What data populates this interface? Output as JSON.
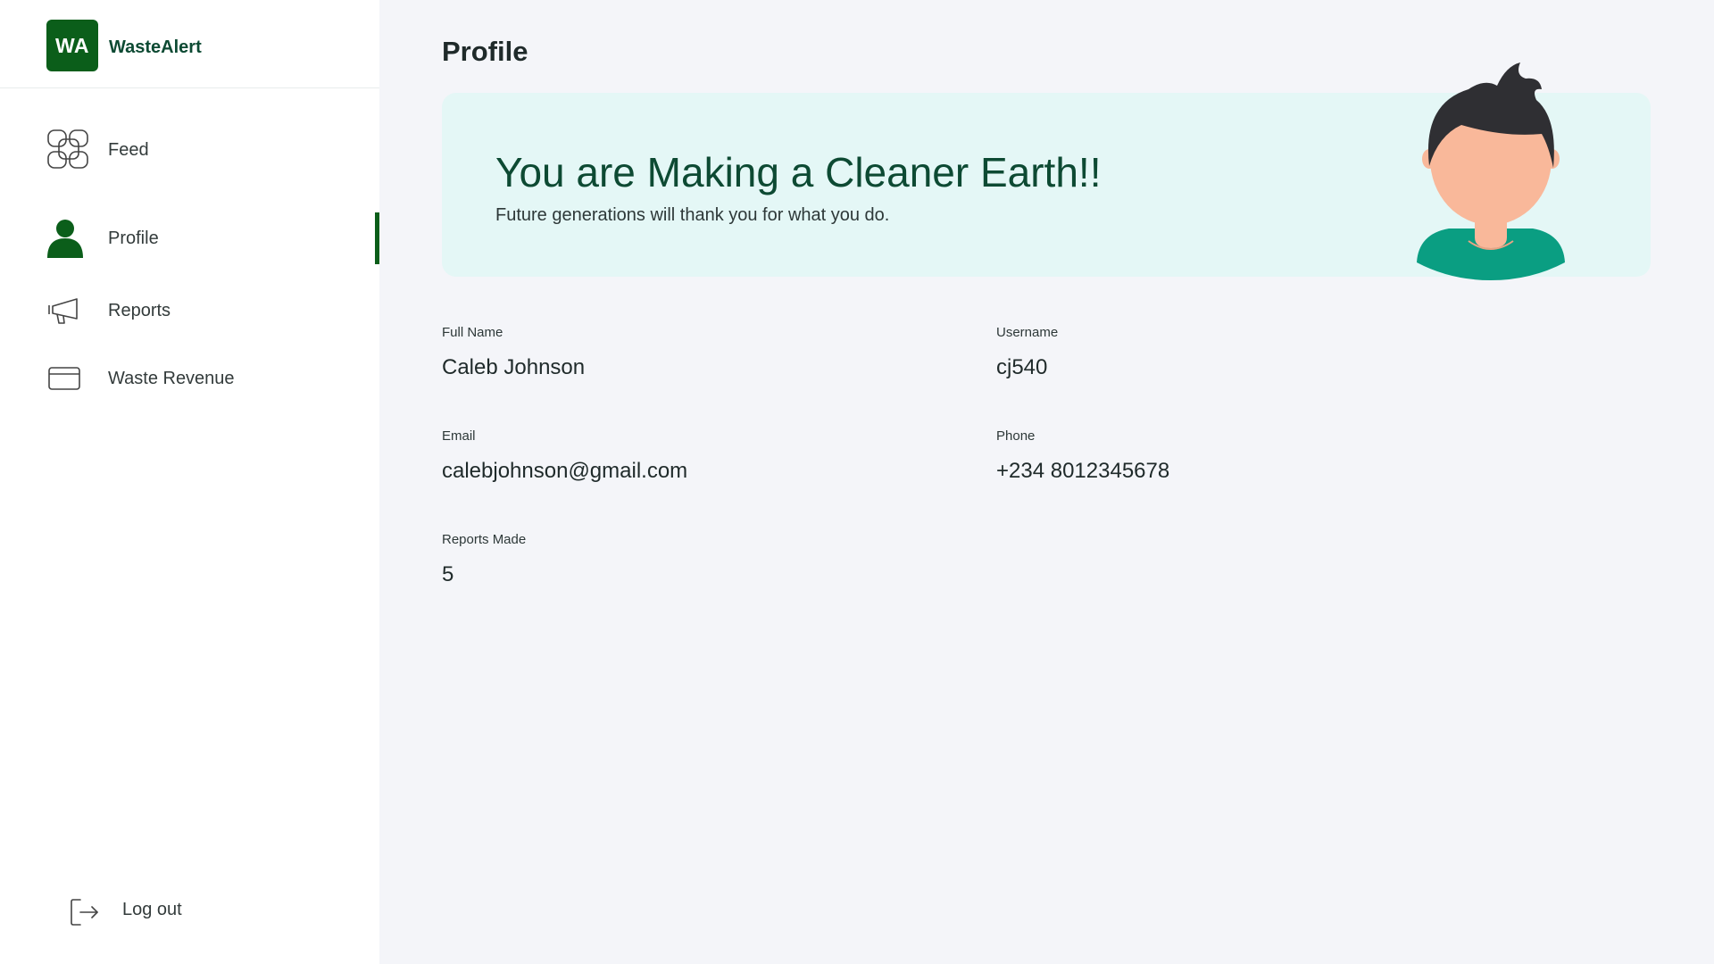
{
  "brand": {
    "logo_text": "WA",
    "name": "WasteAlert",
    "color": "#0b5e1a"
  },
  "sidebar": {
    "items": [
      {
        "label": "Feed",
        "icon": "feed-grid-icon",
        "active": false
      },
      {
        "label": "Profile",
        "icon": "user-icon",
        "active": true
      },
      {
        "label": "Reports",
        "icon": "megaphone-icon",
        "active": false
      },
      {
        "label": "Waste Revenue",
        "icon": "credit-card-icon",
        "active": false
      }
    ],
    "logout_label": "Log out",
    "logout_icon": "logout-icon"
  },
  "main": {
    "page_title": "Profile",
    "banner": {
      "title": "You are Making a Cleaner Earth!!",
      "subtitle": "Future generations will thank you for what you do.",
      "background": "#e4f7f6",
      "illustration": "person-avatar-illustration"
    },
    "fields": {
      "full_name": {
        "label": "Full Name",
        "value": "Caleb Johnson"
      },
      "username": {
        "label": "Username",
        "value": "cj540"
      },
      "email": {
        "label": "Email",
        "value": "calebjohnson@gmail.com"
      },
      "phone": {
        "label": "Phone",
        "value": "+234 8012345678"
      },
      "reports_made": {
        "label": "Reports Made",
        "value": "5"
      }
    }
  }
}
